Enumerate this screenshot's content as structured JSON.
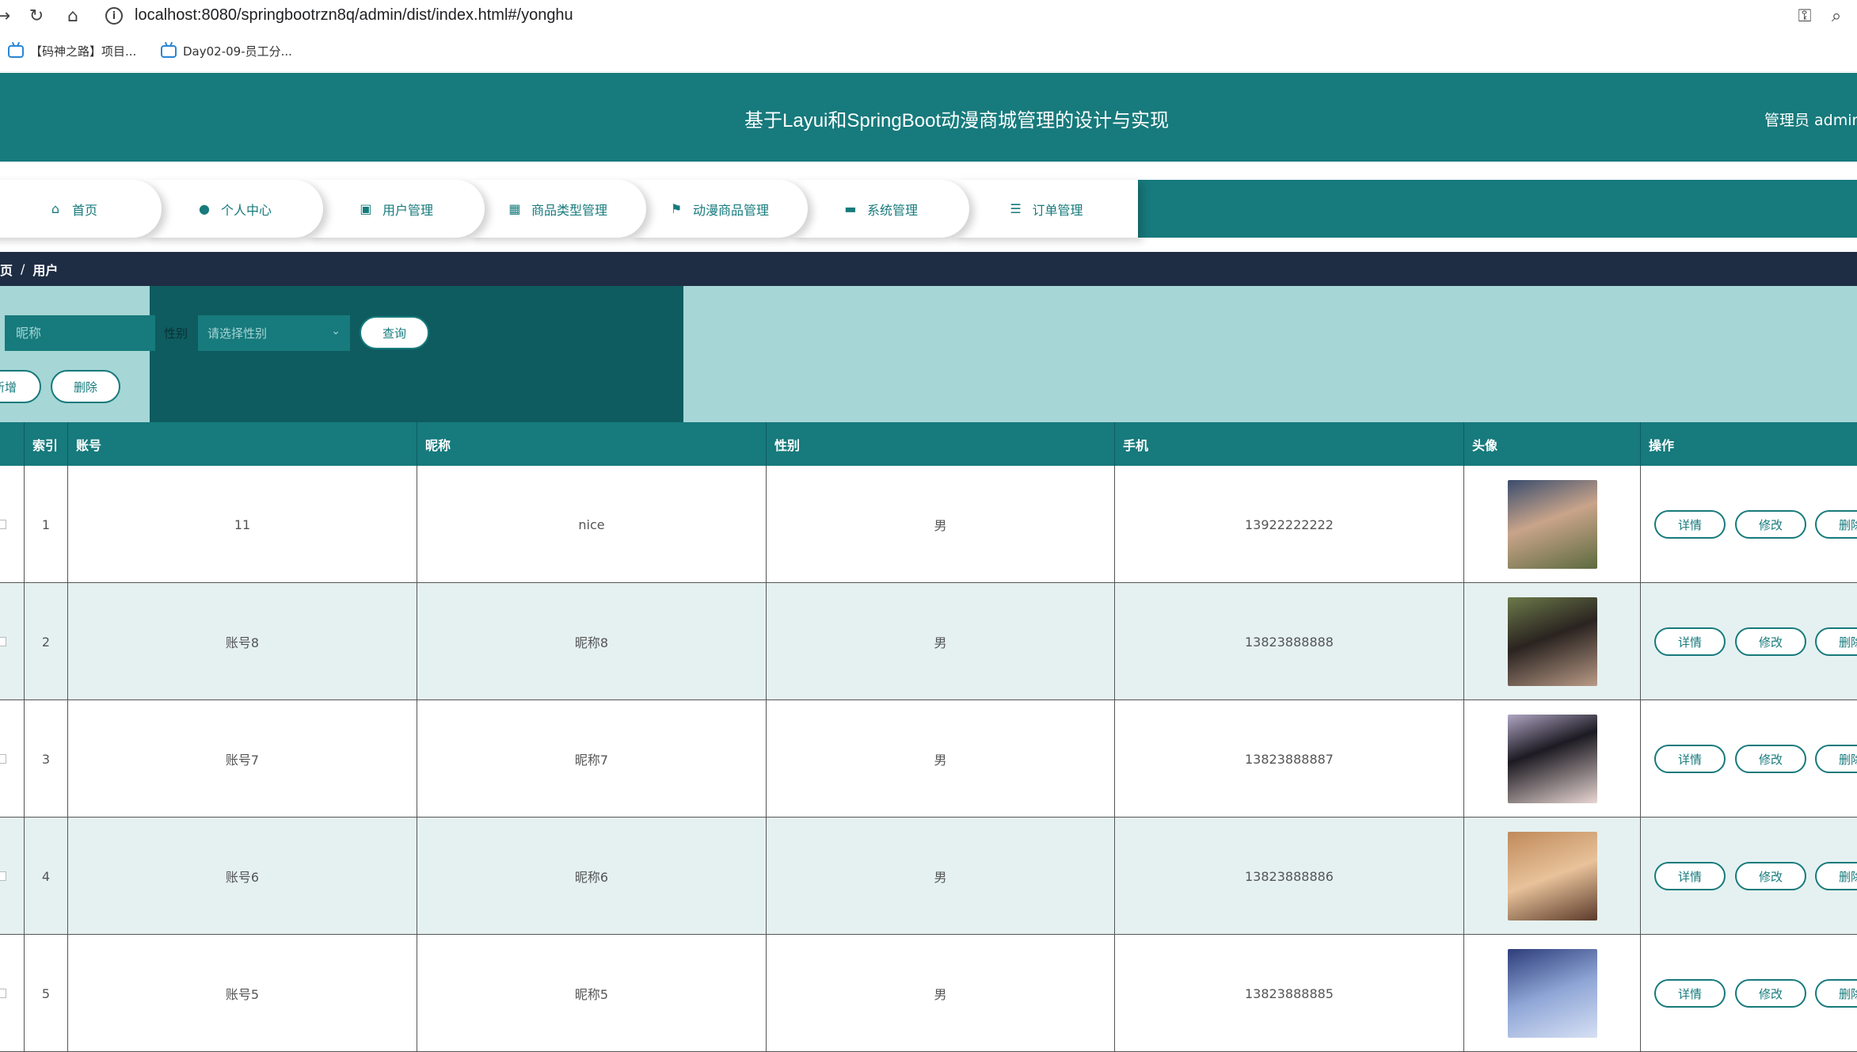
{
  "browser": {
    "url": "localhost:8080/springbootrzn8q/admin/dist/index.html#/yonghu",
    "bookmarks": [
      "【码神之路】项目...",
      "Day02-09-员工分..."
    ]
  },
  "header": {
    "title": "基于Layui和SpringBoot动漫商城管理的设计与实现",
    "admin": "管理员 admin"
  },
  "nav": {
    "items": [
      {
        "label": "首页",
        "icon": "home-icon"
      },
      {
        "label": "个人中心",
        "icon": "user-icon"
      },
      {
        "label": "用户管理",
        "icon": "clipboard-icon"
      },
      {
        "label": "商品类型管理",
        "icon": "grid-icon"
      },
      {
        "label": "动漫商品管理",
        "icon": "flag-icon"
      },
      {
        "label": "系统管理",
        "icon": "briefcase-icon"
      },
      {
        "label": "订单管理",
        "icon": "sliders-icon"
      }
    ]
  },
  "breadcrumb": {
    "home": "页",
    "sep": "/",
    "current": "用户"
  },
  "search": {
    "nickname_placeholder": "昵称",
    "gender_label": "性别",
    "gender_placeholder": "请选择性别",
    "query_label": "查询",
    "add_label": "新增",
    "delete_label": "删除"
  },
  "table": {
    "headers": [
      "",
      "索引",
      "账号",
      "昵称",
      "性别",
      "手机",
      "头像",
      "操作"
    ],
    "rows": [
      {
        "index": "1",
        "account": "11",
        "nickname": "nice",
        "gender": "男",
        "phone": "13922222222"
      },
      {
        "index": "2",
        "account": "账号8",
        "nickname": "昵称8",
        "gender": "男",
        "phone": "13823888888"
      },
      {
        "index": "3",
        "account": "账号7",
        "nickname": "昵称7",
        "gender": "男",
        "phone": "13823888887"
      },
      {
        "index": "4",
        "account": "账号6",
        "nickname": "昵称6",
        "gender": "男",
        "phone": "13823888886"
      },
      {
        "index": "5",
        "account": "账号5",
        "nickname": "昵称5",
        "gender": "男",
        "phone": "13823888885"
      }
    ],
    "actions": {
      "detail": "详情",
      "edit": "修改",
      "delete": "删除"
    }
  },
  "colors": {
    "primary": "#177a7c",
    "dark_panel": "#0e5c60",
    "light_panel": "#a6d6d6",
    "breadcrumb_bg": "#1e2d44",
    "row_alt": "#e5f1f1"
  }
}
